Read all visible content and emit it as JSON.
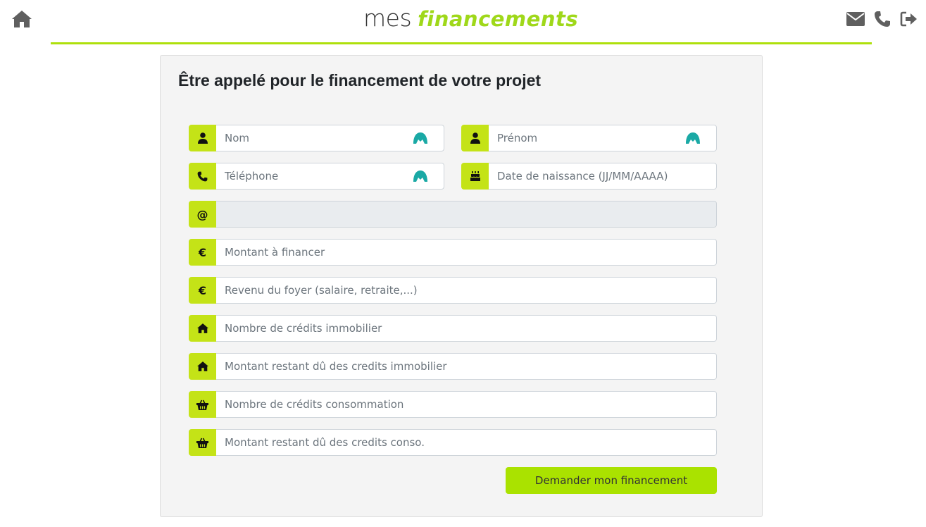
{
  "header": {
    "logo_prefix": "mes",
    "logo_brand": "financements",
    "brand_color": "#aee00b",
    "icons": [
      "home-icon",
      "envelope-icon",
      "phone-icon",
      "sign-out-icon"
    ]
  },
  "form": {
    "title": "Être appelé pour le financement de votre projet",
    "fields": [
      {
        "icon": "user-icon",
        "placeholder": "Nom",
        "value": "",
        "autofill_badge": true
      },
      {
        "icon": "user-icon",
        "placeholder": "Prénom",
        "value": "",
        "autofill_badge": true
      },
      {
        "icon": "phone-icon",
        "placeholder": "Téléphone",
        "value": "",
        "autofill_badge": true
      },
      {
        "icon": "birthday-cake-icon",
        "placeholder": "Date de naissance (JJ/MM/AAAA)",
        "value": ""
      },
      {
        "icon": "at-icon",
        "placeholder": "",
        "value": "",
        "disabled": true
      },
      {
        "icon": "euro-icon",
        "placeholder": "Montant à financer",
        "value": ""
      },
      {
        "icon": "euro-icon",
        "placeholder": "Revenu du foyer (salaire, retraite,...)",
        "value": ""
      },
      {
        "icon": "home-icon",
        "placeholder": "Nombre de crédits immobilier",
        "value": ""
      },
      {
        "icon": "home-icon",
        "placeholder": "Montant restant dû des credits immobilier",
        "value": ""
      },
      {
        "icon": "basket-icon",
        "placeholder": "Nombre de crédits consommation",
        "value": ""
      },
      {
        "icon": "basket-icon",
        "placeholder": "Montant restant dû des credits conso.",
        "value": ""
      }
    ],
    "submit_label": "Demander mon financement"
  }
}
